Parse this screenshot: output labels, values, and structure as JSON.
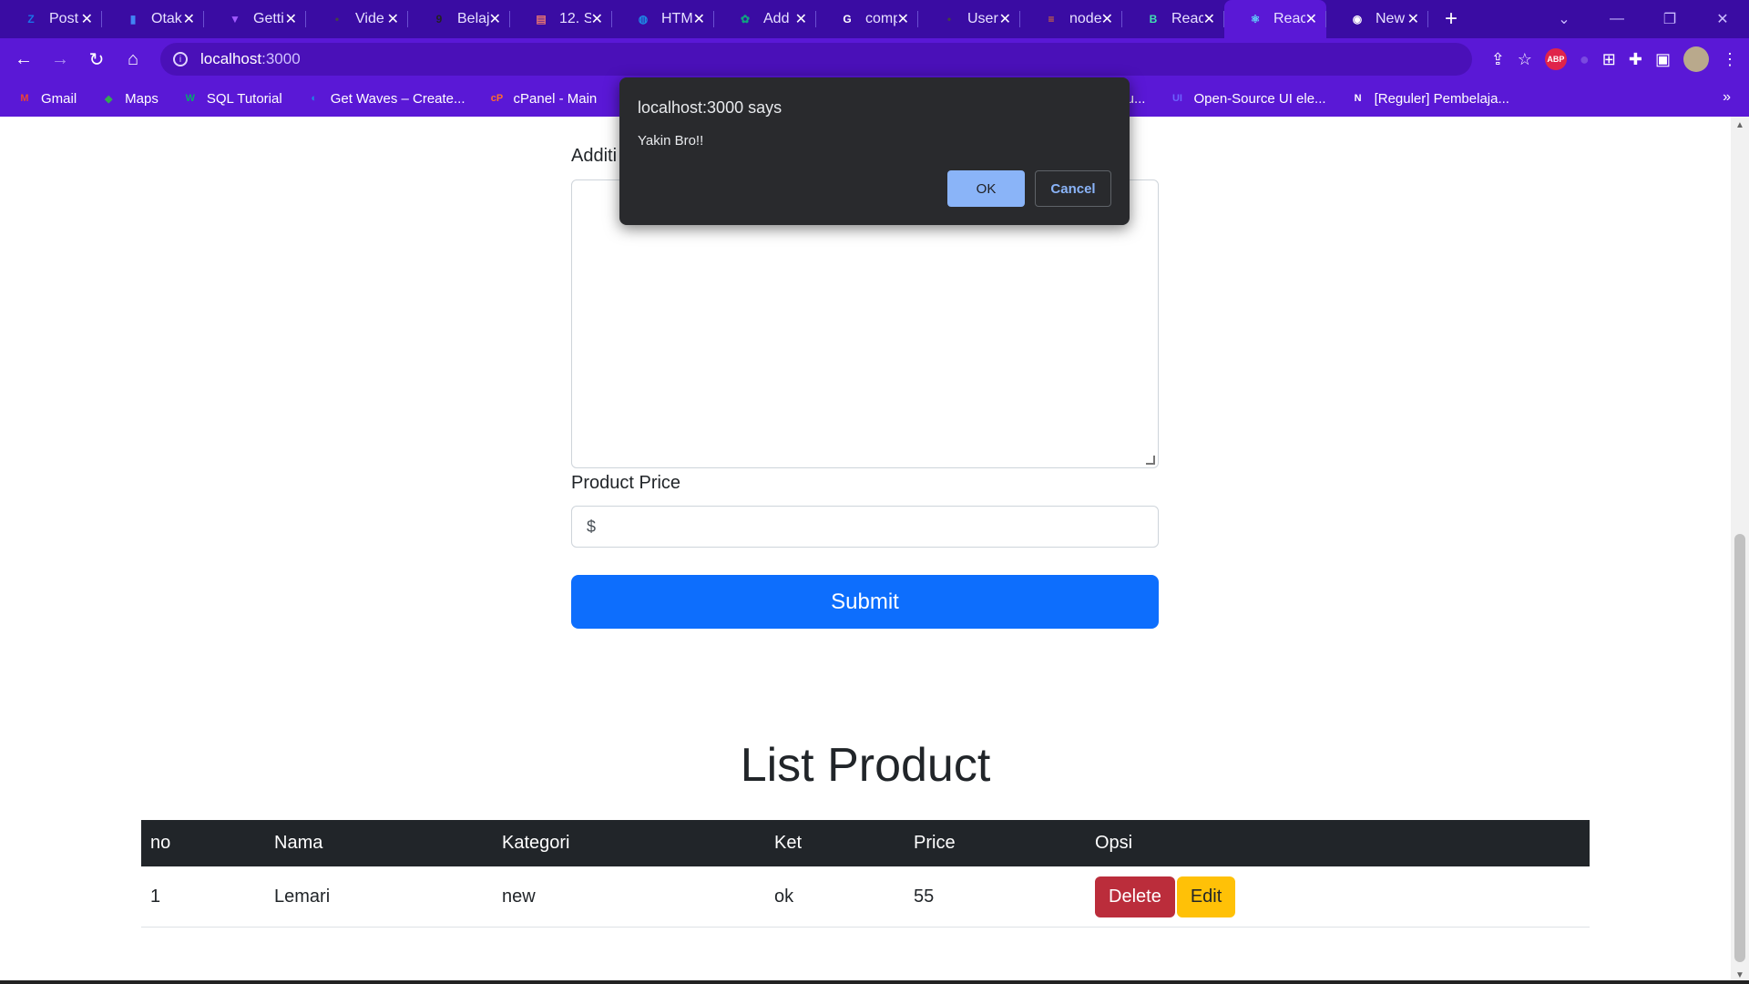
{
  "browser": {
    "tabs": [
      {
        "title": "Post",
        "icon": "zoho-icon",
        "color": "#1a73e8",
        "glyph": "Z"
      },
      {
        "title": "Otak",
        "icon": "doc-icon",
        "color": "#4285f4",
        "glyph": "▮"
      },
      {
        "title": "Getti",
        "icon": "vite-icon",
        "color": "#a259ff",
        "glyph": "▼"
      },
      {
        "title": "Vide",
        "icon": "dash-icon",
        "color": "#444",
        "glyph": "•"
      },
      {
        "title": "Belaj",
        "icon": "g-icon",
        "color": "#222",
        "glyph": "9"
      },
      {
        "title": "12. S",
        "icon": "book-icon",
        "color": "#e57373",
        "glyph": "▤"
      },
      {
        "title": "HTM",
        "icon": "globe-icon",
        "color": "#1e88e5",
        "glyph": "◍"
      },
      {
        "title": "Add",
        "icon": "chatgpt-icon",
        "color": "#10a37f",
        "glyph": "✿"
      },
      {
        "title": "comp",
        "icon": "google-icon",
        "color": "#ffffff",
        "glyph": "G"
      },
      {
        "title": "User",
        "icon": "dash-icon",
        "color": "#444",
        "glyph": "•"
      },
      {
        "title": "node",
        "icon": "stackoverflow-icon",
        "color": "#f48024",
        "glyph": "≡"
      },
      {
        "title": "Reac",
        "icon": "react-bootstrap-icon",
        "color": "#41e0b2",
        "glyph": "B"
      },
      {
        "title": "Reac",
        "icon": "react-icon",
        "color": "#61dafb",
        "glyph": "⚛",
        "active": true
      },
      {
        "title": "New",
        "icon": "chrome-icon",
        "color": "#ffffff",
        "glyph": "◉"
      }
    ],
    "new_tab": "+",
    "address": {
      "host": "localhost",
      "port": ":3000"
    },
    "bookmarks": [
      {
        "label": "Gmail",
        "icon": "gmail-icon",
        "color": "#ea4335",
        "glyph": "M"
      },
      {
        "label": "Maps",
        "icon": "maps-icon",
        "color": "#34a853",
        "glyph": "◆"
      },
      {
        "label": "SQL Tutorial",
        "icon": "w3-icon",
        "color": "#04aa6d",
        "glyph": "W"
      },
      {
        "label": "Get Waves – Create...",
        "icon": "waves-icon",
        "color": "#1e88e5",
        "glyph": "◐"
      },
      {
        "label": "cPanel - Main",
        "icon": "cpanel-icon",
        "color": "#ff6c2c",
        "glyph": "cP"
      },
      {
        "label": "",
        "icon": "colorful-icon",
        "color": "#ff9800",
        "glyph": "◆"
      },
      {
        "label": "evDocs API Docu...",
        "icon": "devdocs-icon",
        "color": "#333",
        "glyph": ""
      },
      {
        "label": "Open-Source UI ele...",
        "icon": "ui-icon",
        "color": "#6c63ff",
        "glyph": "UI"
      },
      {
        "label": "[Reguler] Pembelaja...",
        "icon": "notion-icon",
        "color": "#ffffff",
        "glyph": "N"
      }
    ]
  },
  "form": {
    "additional_label": "Additi",
    "price_label": "Product Price",
    "price_placeholder": "$",
    "submit_label": "Submit"
  },
  "list": {
    "heading": "List Product",
    "columns": [
      "no",
      "Nama",
      "Kategori",
      "Ket",
      "Price",
      "Opsi"
    ],
    "rows": [
      {
        "no": "1",
        "nama": "Lemari",
        "kategori": "new",
        "ket": "ok",
        "price": "55",
        "delete": "Delete",
        "edit": "Edit"
      }
    ]
  },
  "dialog": {
    "title": "localhost:3000 says",
    "message": "Yakin Bro!!",
    "ok": "OK",
    "cancel": "Cancel"
  }
}
